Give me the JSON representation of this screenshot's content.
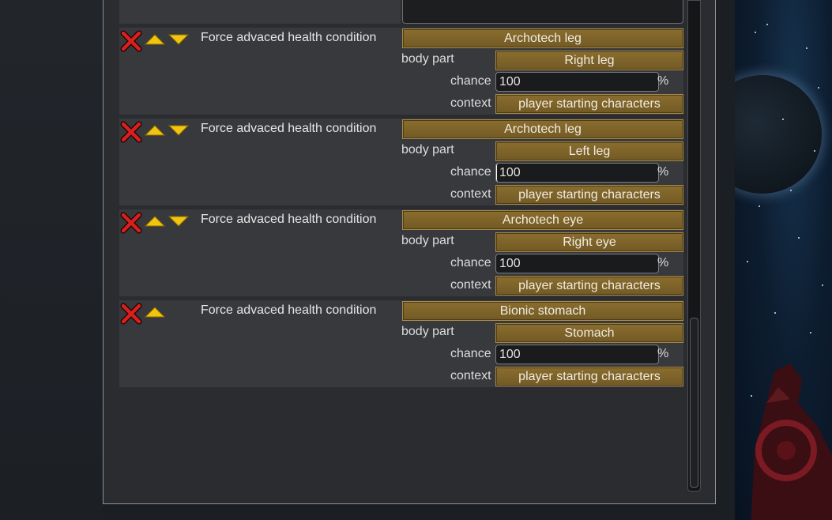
{
  "colors": {
    "accent_button": "#7e6229",
    "window_bg": "#2a2c2f",
    "row_bg": "#38393c",
    "delete_red": "#d21e1e",
    "arrow_yellow": "#f1c40f"
  },
  "entries": [
    {
      "label": "Force advaced health condition",
      "condition": "Archotech leg",
      "body_part_label": "body part",
      "body_part": "Right leg",
      "chance_label": "chance",
      "chance": "100",
      "percent": "%",
      "context_label": "context",
      "context": "player starting characters",
      "has_up": true,
      "has_down": true
    },
    {
      "label": "Force advaced health condition",
      "condition": "Archotech leg",
      "body_part_label": "body part",
      "body_part": "Left leg",
      "chance_label": "chance",
      "chance": "100",
      "percent": "%",
      "context_label": "context",
      "context": "player starting characters",
      "has_up": true,
      "has_down": true
    },
    {
      "label": "Force advaced health condition",
      "condition": "Archotech eye",
      "body_part_label": "body part",
      "body_part": "Right eye",
      "chance_label": "chance",
      "chance": "100",
      "percent": "%",
      "context_label": "context",
      "context": "player starting characters",
      "has_up": true,
      "has_down": true
    },
    {
      "label": "Force advaced health condition",
      "condition": "Bionic stomach",
      "body_part_label": "body part",
      "body_part": "Stomach",
      "chance_label": "chance",
      "chance": "100",
      "percent": "%",
      "context_label": "context",
      "context": "player starting characters",
      "has_up": true,
      "has_down": false
    }
  ],
  "icons": {
    "delete": "close-x-icon",
    "up": "arrow-up-icon",
    "down": "arrow-down-icon"
  }
}
